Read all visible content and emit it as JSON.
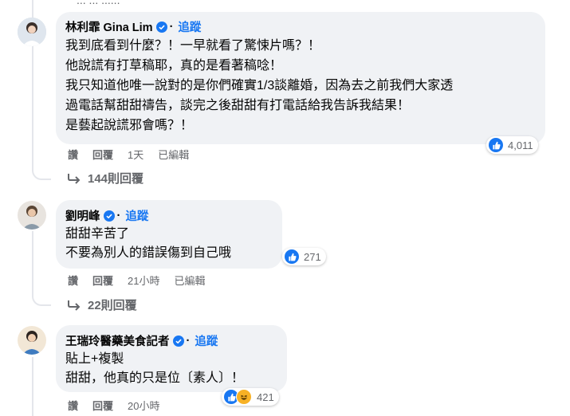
{
  "top_fragment": "... ... ......",
  "comments": [
    {
      "author": "林利霏 Gina Lim",
      "follow_label": "追蹤",
      "dot": "·",
      "lines": [
        "我到底看到什麼？！一早就看了驚悚片嗎？！",
        "他說謊有打草稿耶，真的是看著稿唸！",
        "我只知道他唯一說對的是你們確實1/3談離婚，因為去之前我們大家透",
        "過電話幫甜甜禱告，談完之後甜甜有打電話給我告訴我結果！",
        "是藝起說謊邪會嗎？！"
      ],
      "reaction_count": "4,011",
      "actions": {
        "like": "讚",
        "reply": "回覆",
        "time": "1天",
        "edited": "已編輯"
      },
      "replies_label": "144則回覆"
    },
    {
      "author": "劉明峰",
      "follow_label": "追蹤",
      "dot": "·",
      "lines": [
        "甜甜辛苦了",
        "不要為別人的錯誤傷到自己哦"
      ],
      "reaction_count": "271",
      "actions": {
        "like": "讚",
        "reply": "回覆",
        "time": "21小時",
        "edited": "已編輯"
      },
      "replies_label": "22則回覆"
    },
    {
      "author": "王瑞玲醫藥美食記者",
      "follow_label": "追蹤",
      "dot": "·",
      "lines": [
        "貼上+複製",
        "甜甜，他真的只是位〔素人〕！"
      ],
      "reaction_count": "421",
      "actions": {
        "like": "讚",
        "reply": "回覆",
        "time": "20小時"
      }
    }
  ],
  "colors": {
    "accent": "#1877f2",
    "bubble": "#f0f2f5",
    "meta": "#65676b"
  }
}
